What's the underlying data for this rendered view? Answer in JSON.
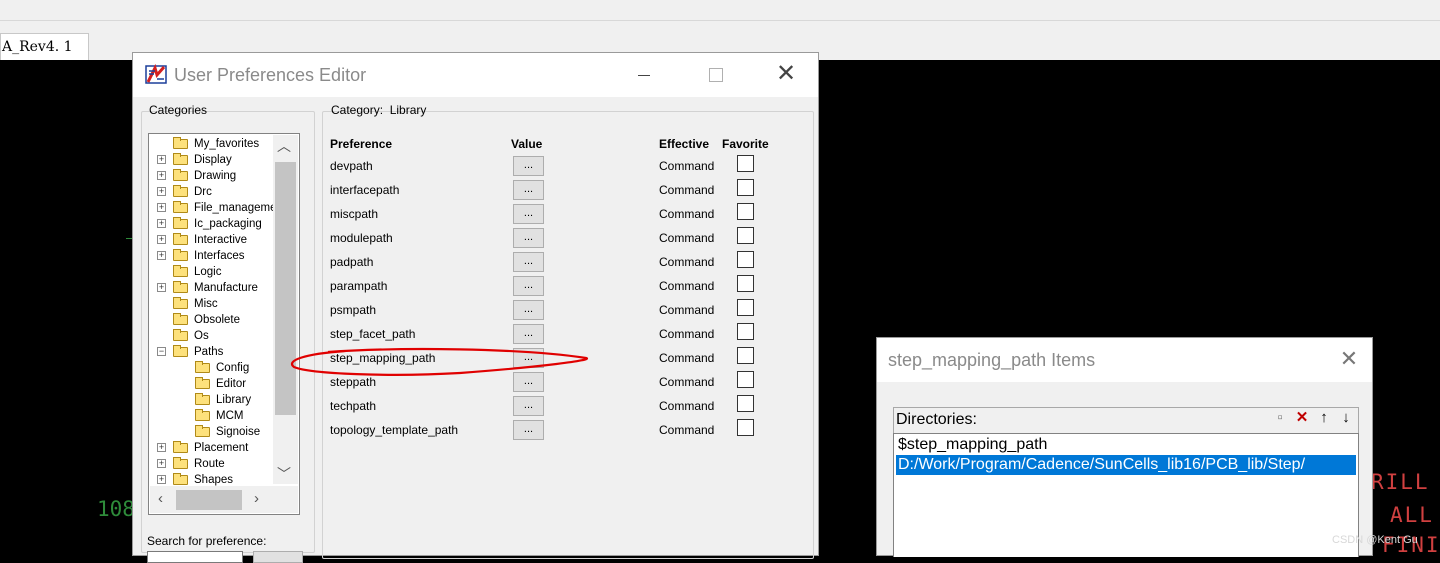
{
  "background": {
    "tab_label": "A_Rev4. 1",
    "cad_texts": {
      "left_number": "108",
      "rill": "RILL",
      "all": "ALL",
      "fini": "FINI"
    },
    "watermark": "CSDN @Kent Gu"
  },
  "preferences_dialog": {
    "title": "User Preferences Editor",
    "categories_label": "Categories",
    "category_prefix": "Category:",
    "category_value": "Library",
    "search_label": "Search for preference:",
    "tree": [
      {
        "label": "My_favorites",
        "expander": "",
        "indent": 0
      },
      {
        "label": "Display",
        "expander": "+",
        "indent": 0
      },
      {
        "label": "Drawing",
        "expander": "+",
        "indent": 0
      },
      {
        "label": "Drc",
        "expander": "+",
        "indent": 0
      },
      {
        "label": "File_managemer",
        "expander": "+",
        "indent": 0
      },
      {
        "label": "Ic_packaging",
        "expander": "+",
        "indent": 0
      },
      {
        "label": "Interactive",
        "expander": "+",
        "indent": 0
      },
      {
        "label": "Interfaces",
        "expander": "+",
        "indent": 0
      },
      {
        "label": "Logic",
        "expander": "",
        "indent": 0
      },
      {
        "label": "Manufacture",
        "expander": "+",
        "indent": 0
      },
      {
        "label": "Misc",
        "expander": "",
        "indent": 0
      },
      {
        "label": "Obsolete",
        "expander": "",
        "indent": 0
      },
      {
        "label": "Os",
        "expander": "",
        "indent": 0
      },
      {
        "label": "Paths",
        "expander": "−",
        "indent": 0
      },
      {
        "label": "Config",
        "expander": "",
        "indent": 1
      },
      {
        "label": "Editor",
        "expander": "",
        "indent": 1
      },
      {
        "label": "Library",
        "expander": "",
        "indent": 1
      },
      {
        "label": "MCM",
        "expander": "",
        "indent": 1
      },
      {
        "label": "Signoise",
        "expander": "",
        "indent": 1
      },
      {
        "label": "Placement",
        "expander": "+",
        "indent": 0
      },
      {
        "label": "Route",
        "expander": "+",
        "indent": 0
      },
      {
        "label": "Shapes",
        "expander": "+",
        "indent": 0
      }
    ],
    "columns": {
      "preference": "Preference",
      "value": "Value",
      "effective": "Effective",
      "favorite": "Favorite"
    },
    "value_button_label": "...",
    "rows": [
      {
        "name": "devpath",
        "effective": "Command"
      },
      {
        "name": "interfacepath",
        "effective": "Command"
      },
      {
        "name": "miscpath",
        "effective": "Command"
      },
      {
        "name": "modulepath",
        "effective": "Command"
      },
      {
        "name": "padpath",
        "effective": "Command"
      },
      {
        "name": "parampath",
        "effective": "Command"
      },
      {
        "name": "psmpath",
        "effective": "Command"
      },
      {
        "name": "step_facet_path",
        "effective": "Command"
      },
      {
        "name": "step_mapping_path",
        "effective": "Command"
      },
      {
        "name": "steppath",
        "effective": "Command"
      },
      {
        "name": "techpath",
        "effective": "Command"
      },
      {
        "name": "topology_template_path",
        "effective": "Command"
      }
    ]
  },
  "items_dialog": {
    "title": "step_mapping_path Items",
    "directories_label": "Directories:",
    "directories": [
      {
        "path": "$step_mapping_path",
        "selected": false
      },
      {
        "path": "D:/Work/Program/Cadence/SunCells_lib16/PCB_lib/Step/",
        "selected": true
      }
    ]
  }
}
